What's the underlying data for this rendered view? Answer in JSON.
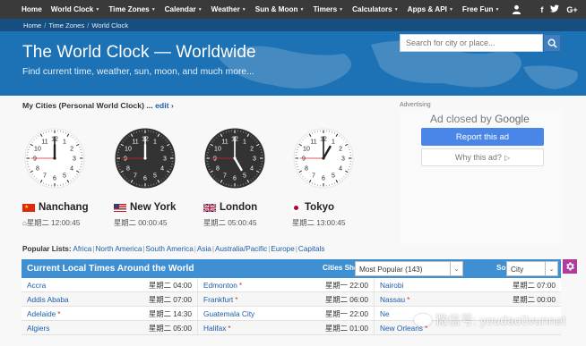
{
  "nav": {
    "items": [
      "Home",
      "World Clock",
      "Time Zones",
      "Calendar",
      "Weather",
      "Sun & Moon",
      "Timers",
      "Calculators",
      "Apps & API",
      "Free Fun"
    ],
    "social": [
      "f",
      "G+"
    ]
  },
  "breadcrumb": [
    "Home",
    "Time Zones",
    "World Clock"
  ],
  "header": {
    "title": "The World Clock — Worldwide",
    "subtitle": "Find current time, weather, sun, moon, and much more...",
    "search_placeholder": "Search for city or place..."
  },
  "mycities": {
    "label": "My Cities (Personal World Clock) ...",
    "edit": "edit ›"
  },
  "cities": [
    {
      "name": "Nanchang",
      "time": "星期二 12:00:45",
      "hour": 12,
      "minute": 0,
      "second": 45,
      "face": "white",
      "flag": "cn"
    },
    {
      "name": "New York",
      "time": "星期二 00:00:45",
      "hour": 0,
      "minute": 0,
      "second": 45,
      "face": "dark",
      "flag": "us"
    },
    {
      "name": "London",
      "time": "星期二 05:00:45",
      "hour": 5,
      "minute": 0,
      "second": 45,
      "face": "dark",
      "flag": "gb"
    },
    {
      "name": "Tokyo",
      "time": "星期二 13:00:45",
      "hour": 13,
      "minute": 0,
      "second": 45,
      "face": "white",
      "flag": "jp"
    }
  ],
  "clock_numbers": [
    "12",
    "1",
    "2",
    "3",
    "4",
    "5",
    "6",
    "7",
    "8",
    "9",
    "10",
    "11"
  ],
  "ad": {
    "label": "Advertising",
    "closed": "Ad closed by",
    "brand": "Google",
    "report": "Report this ad",
    "why": "Why this ad?",
    "why_icon": "▷"
  },
  "popular": {
    "label": "Popular Lists:",
    "links": [
      "Africa",
      "North America",
      "South America",
      "Asia",
      "Australia/Pacific",
      "Europe",
      "Capitals"
    ]
  },
  "table": {
    "title": "Current Local Times Around the World",
    "cities_shown_label": "Cities Shown:",
    "cities_shown_value": "Most Popular (143)",
    "sort_label": "Sort By:",
    "sort_value": "City",
    "rows": [
      [
        {
          "city": "Accra",
          "star": "",
          "time": "星期二 04:00"
        },
        {
          "city": "Edmonton",
          "star": "*",
          "time": "星期一 22:00"
        },
        {
          "city": "Nairobi",
          "star": "",
          "time": "星期二 07:00"
        }
      ],
      [
        {
          "city": "Addis Ababa",
          "star": "",
          "time": "星期二 07:00"
        },
        {
          "city": "Frankfurt",
          "star": "*",
          "time": "星期二 06:00"
        },
        {
          "city": "Nassau",
          "star": "*",
          "time": "星期二 00:00"
        }
      ],
      [
        {
          "city": "Adelaide",
          "star": "*",
          "time": "星期二 14:30"
        },
        {
          "city": "Guatemala City",
          "star": "",
          "time": "星期一 22:00"
        },
        {
          "city": "Ne",
          "star": "",
          "time": ""
        }
      ],
      [
        {
          "city": "Algiers",
          "star": "",
          "time": "星期二 05:00"
        },
        {
          "city": "Halifax",
          "star": "*",
          "time": "星期二 01:00"
        },
        {
          "city": "New Orleans",
          "star": "*",
          "time": ""
        }
      ]
    ]
  },
  "watermark": "微信号: youdao0vunnet"
}
